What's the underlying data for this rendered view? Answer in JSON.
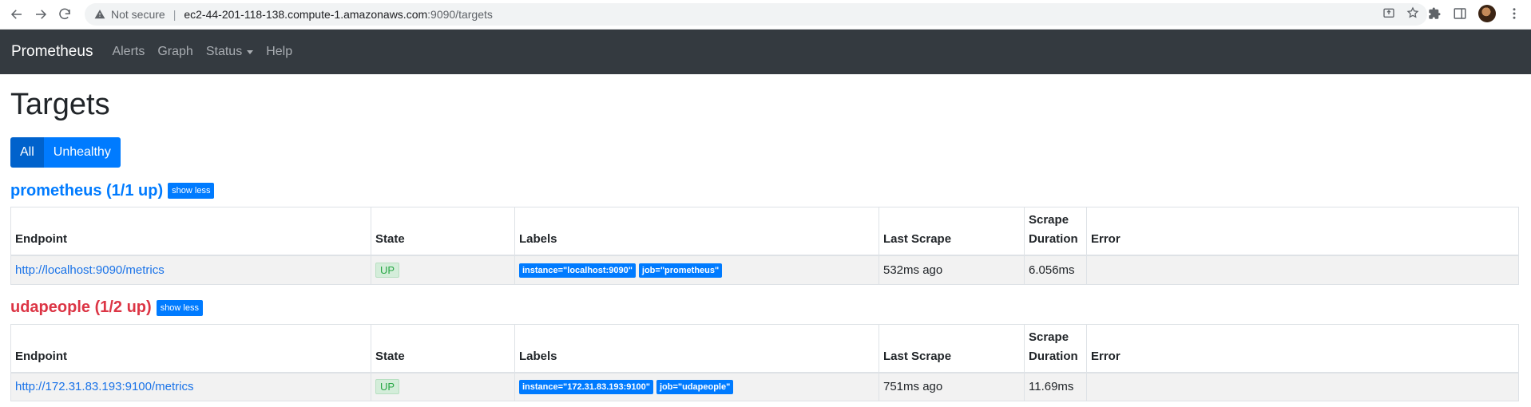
{
  "browser": {
    "security_text": "Not secure",
    "url_host": "ec2-44-201-118-138.compute-1.amazonaws.com",
    "url_path": ":9090/targets"
  },
  "navbar": {
    "brand": "Prometheus",
    "links": [
      "Alerts",
      "Graph",
      "Status",
      "Help"
    ]
  },
  "page": {
    "title": "Targets",
    "filters": [
      "All",
      "Unhealthy"
    ]
  },
  "jobs": [
    {
      "title": "prometheus (1/1 up)",
      "toggle_label": "show less",
      "columns": [
        "Endpoint",
        "State",
        "Labels",
        "Last Scrape",
        "Scrape Duration",
        "Error"
      ],
      "rows": [
        {
          "endpoint": "http://localhost:9090/metrics",
          "state": "UP",
          "labels": [
            "instance=\"localhost:9090\"",
            "job=\"prometheus\""
          ],
          "last_scrape": "532ms ago",
          "scrape_duration": "6.056ms",
          "error": ""
        }
      ]
    },
    {
      "title": "udapeople (1/2 up)",
      "toggle_label": "show less",
      "columns": [
        "Endpoint",
        "State",
        "Labels",
        "Last Scrape",
        "Scrape Duration",
        "Error"
      ],
      "rows": [
        {
          "endpoint": "http://172.31.83.193:9100/metrics",
          "state": "UP",
          "labels": [
            "instance=\"172.31.83.193:9100\"",
            "job=\"udapeople\""
          ],
          "last_scrape": "751ms ago",
          "scrape_duration": "11.69ms",
          "error": ""
        }
      ]
    }
  ],
  "colors": {
    "navbar_bg": "#343a40",
    "primary": "#007bff",
    "danger": "#dc3545",
    "success": "#28a745"
  }
}
